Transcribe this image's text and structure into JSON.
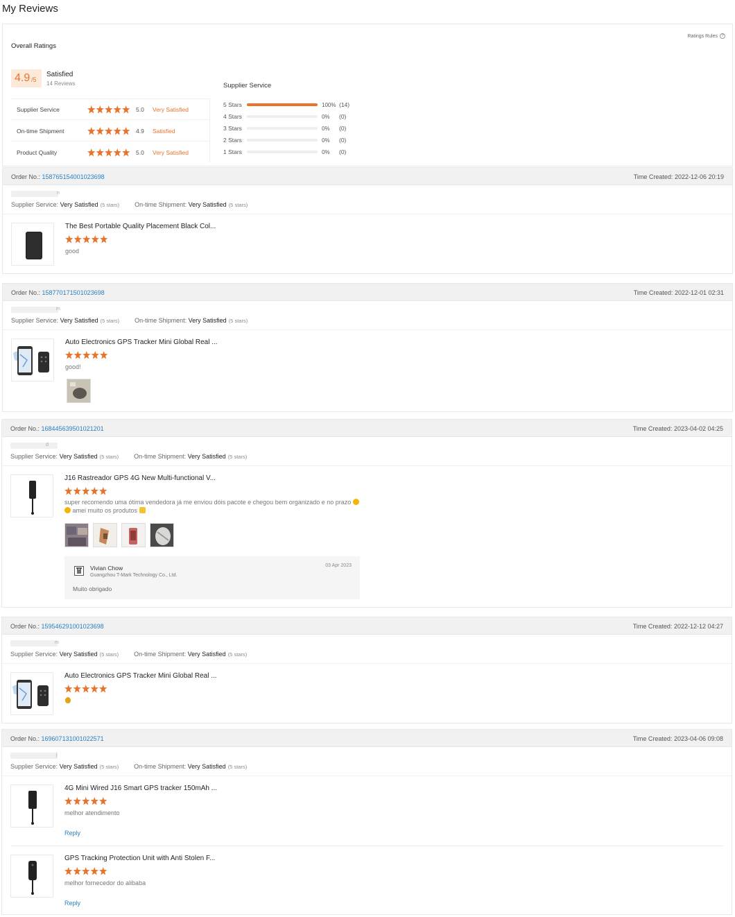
{
  "page": {
    "title": "My Reviews"
  },
  "summary": {
    "heading": "Overall Ratings",
    "rules_link": "Ratings Rules",
    "score": "4.9",
    "score_max": "/5",
    "score_label": "Satisfied",
    "review_count": "14 Reviews",
    "categories": [
      {
        "name": "Supplier Service",
        "stars": 5,
        "value": "5.0",
        "label": "Very Satisfied"
      },
      {
        "name": "On-time Shipment",
        "stars": 5,
        "value": "4.9",
        "label": "Satisfied"
      },
      {
        "name": "Product Quality",
        "stars": 5,
        "value": "5.0",
        "label": "Very Satisfied"
      }
    ],
    "breakdown_title": "Supplier Service",
    "breakdown": [
      {
        "label": "5 Stars",
        "fraction": 1.0,
        "pct": "100%",
        "count": "(14)"
      },
      {
        "label": "4 Stars",
        "fraction": 0,
        "pct": "0%",
        "count": "(0)"
      },
      {
        "label": "3 Stars",
        "fraction": 0,
        "pct": "0%",
        "count": "(0)"
      },
      {
        "label": "2 Stars",
        "fraction": 0,
        "pct": "0%",
        "count": "(0)"
      },
      {
        "label": "1 Stars",
        "fraction": 0,
        "pct": "0%",
        "count": "(0)"
      }
    ]
  },
  "labels": {
    "order_no": "Order No.:",
    "time_created": "Time Created:",
    "supplier_service": "Supplier Service:",
    "ontime_shipment": "On-time Shipment:",
    "very_satisfied": "Very Satisfied",
    "five_stars": "(5 stars)",
    "reply": "Reply"
  },
  "orders": [
    {
      "order_no": "158765154001023698",
      "time_created": "2022-12-06 20:19",
      "buyer_tail": "n",
      "items": [
        {
          "name": "The Best Portable Quality Placement Black Col...",
          "stars": 5,
          "review": "good"
        }
      ]
    },
    {
      "order_no": "158770171501023698",
      "time_created": "2022-12-01 02:31",
      "buyer_tail": "m",
      "items": [
        {
          "name": "Auto Electronics GPS Tracker Mini Global Real ...",
          "stars": 5,
          "review": "good!"
        }
      ]
    },
    {
      "order_no": "168445639501021201",
      "time_created": "2023-04-02 04:25",
      "buyer_tail": "d",
      "items": [
        {
          "name": "J16 Rastreador GPS 4G New Multi-functional V...",
          "stars": 5,
          "review_line1": "super recomendo uma ótima vendedora já me enviou dóis pacote e chegou bem organizado e no prazo",
          "review_line2": "amei muito os produtos"
        }
      ],
      "supplier_reply": {
        "name": "Vivian Chow",
        "company": "Guangzhou T-Mark Technology Co., Ltd.",
        "date": "03 Apr 2023",
        "text": "Muito obrigado"
      }
    },
    {
      "order_no": "159546291001023698",
      "time_created": "2022-12-12 04:27",
      "buyer_tail": "m",
      "items": [
        {
          "name": "Auto Electronics GPS Tracker Mini Global Real ...",
          "stars": 5,
          "review": ""
        }
      ]
    },
    {
      "order_no": "169607131001022571",
      "time_created": "2023-04-06 09:08",
      "buyer_tail": "j",
      "items": [
        {
          "name": "4G Mini Wired J16 Smart GPS tracker 150mAh ...",
          "stars": 5,
          "review": "melhor atendimento"
        },
        {
          "name": "GPS Tracking Protection Unit with Anti Stolen F...",
          "stars": 5,
          "review": "melhor fornecedor do alibaba"
        }
      ]
    }
  ],
  "colors": {
    "accent": "#e8742b",
    "link": "#2a7fc1",
    "header_bg": "#f1f1f1"
  }
}
